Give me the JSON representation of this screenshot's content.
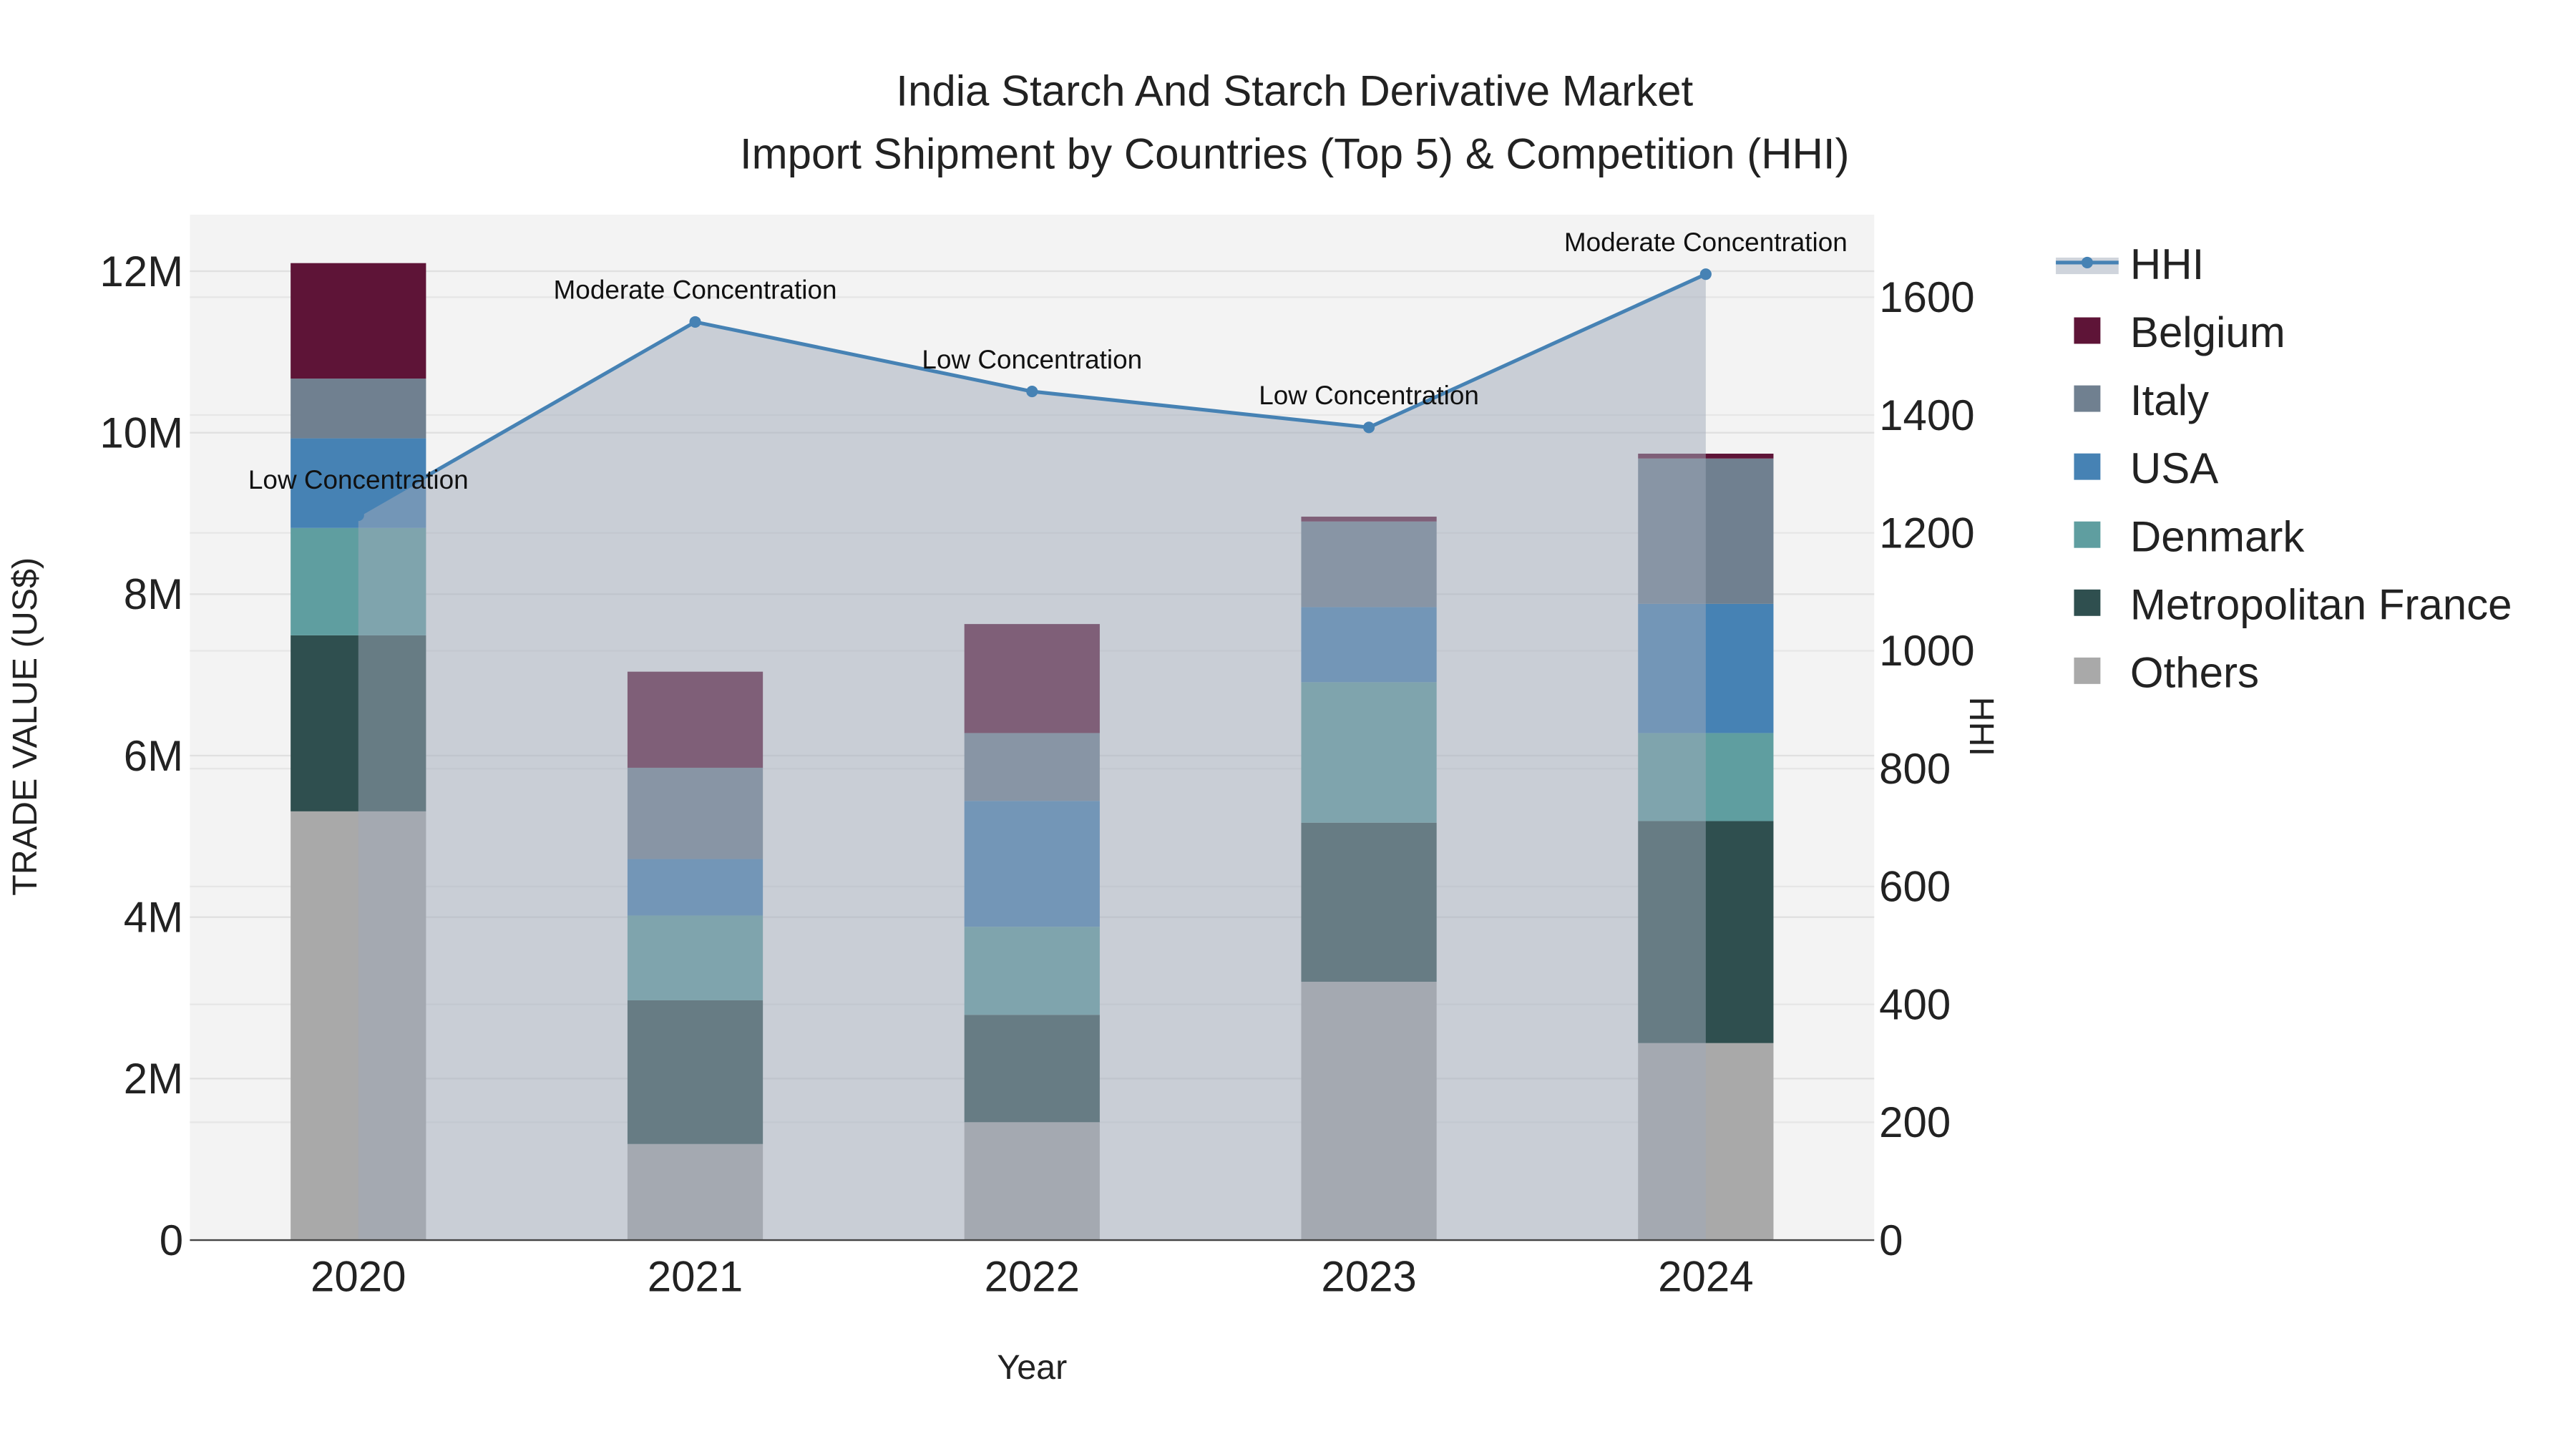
{
  "chart_data": {
    "type": "bar",
    "stacked": true,
    "title": "India Starch And Starch Derivative Market",
    "subtitle": "Import Shipment by Countries (Top 5) & Competition (HHI)",
    "xlabel": "Year",
    "ylabel": "TRADE VALUE (US$)",
    "y2label": "HHI",
    "categories": [
      "2020",
      "2021",
      "2022",
      "2023",
      "2024"
    ],
    "ylim": [
      0,
      12700000
    ],
    "y2lim": [
      0,
      1740
    ],
    "yticks": [
      {
        "v": 0,
        "label": "0"
      },
      {
        "v": 2000000,
        "label": "2M"
      },
      {
        "v": 4000000,
        "label": "4M"
      },
      {
        "v": 6000000,
        "label": "6M"
      },
      {
        "v": 8000000,
        "label": "8M"
      },
      {
        "v": 10000000,
        "label": "10M"
      },
      {
        "v": 12000000,
        "label": "12M"
      }
    ],
    "y2ticks": [
      {
        "v": 0,
        "label": "0"
      },
      {
        "v": 200,
        "label": "200"
      },
      {
        "v": 400,
        "label": "400"
      },
      {
        "v": 600,
        "label": "600"
      },
      {
        "v": 800,
        "label": "800"
      },
      {
        "v": 1000,
        "label": "1000"
      },
      {
        "v": 1200,
        "label": "1200"
      },
      {
        "v": 1400,
        "label": "1400"
      },
      {
        "v": 1600,
        "label": "1600"
      }
    ],
    "series": [
      {
        "name": "Others",
        "color": "#a9a9a9",
        "values": [
          5310000,
          1190000,
          1460000,
          3200000,
          2440000
        ]
      },
      {
        "name": "Metropolitan France",
        "color": "#2f4f4f",
        "values": [
          2180000,
          1780000,
          1330000,
          1970000,
          2750000
        ]
      },
      {
        "name": "Denmark",
        "color": "#5f9ea0",
        "values": [
          1330000,
          1050000,
          1090000,
          1740000,
          1090000
        ]
      },
      {
        "name": "USA",
        "color": "#4682b4",
        "values": [
          1110000,
          700000,
          1560000,
          930000,
          1600000
        ]
      },
      {
        "name": "Italy",
        "color": "#708090",
        "values": [
          740000,
          1130000,
          840000,
          1060000,
          1800000
        ]
      },
      {
        "name": "Belgium",
        "color": "#5e1437",
        "values": [
          1430000,
          1190000,
          1350000,
          60000,
          60000
        ]
      }
    ],
    "hhi": {
      "name": "HHI",
      "color": "#4682b4",
      "values": [
        1230,
        1558,
        1440,
        1379,
        1639
      ],
      "labels": [
        "Low Concentration",
        "Moderate Concentration",
        "Low Concentration",
        "Low Concentration",
        "Moderate Concentration"
      ]
    },
    "legend": {
      "placement": "right",
      "order": [
        "HHI",
        "Belgium",
        "Italy",
        "USA",
        "Denmark",
        "Metropolitan France",
        "Others"
      ]
    },
    "grid": true
  }
}
